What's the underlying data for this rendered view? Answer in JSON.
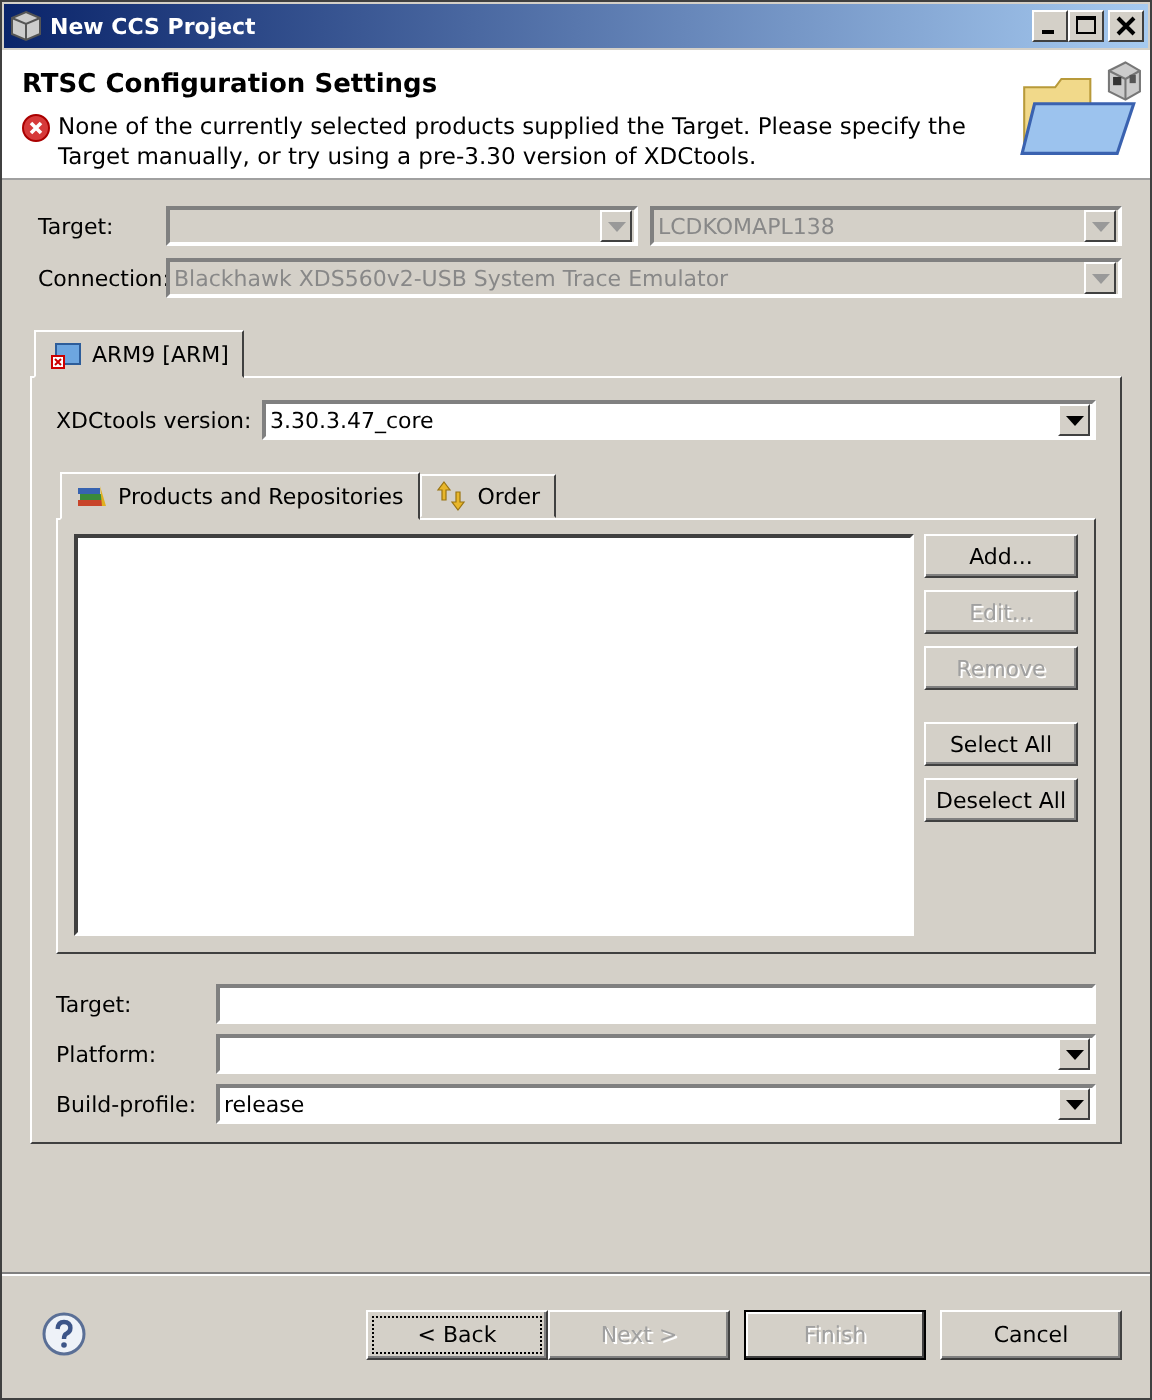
{
  "window": {
    "title": "New CCS Project"
  },
  "header": {
    "title": "RTSC Configuration Settings",
    "message": "None of the currently selected products supplied the Target. Please specify the Target manually, or try using a pre-3.30 version of XDCtools."
  },
  "device": {
    "target_label": "Target:",
    "target_combos": [
      {
        "disabled": true
      },
      {
        "value": "LCDKOMAPL138",
        "disabled": true
      }
    ],
    "connection_label": "Connection:",
    "connection": {
      "value": "Blackhawk XDS560v2-USB System Trace Emulator",
      "disabled": true
    }
  },
  "core_tabs": [
    {
      "label": "ARM9 [ARM]",
      "selected": true
    }
  ],
  "xdctools": {
    "label": "XDCtools version:",
    "value": "3.30.3.47_core"
  },
  "product_tabs": [
    {
      "label": "Products and Repositories",
      "selected": true,
      "kind": "products"
    },
    {
      "label": "Order",
      "selected": false,
      "kind": "order"
    }
  ],
  "side_buttons": [
    {
      "label": "Add...",
      "disabled": false
    },
    {
      "label": "Edit...",
      "disabled": true
    },
    {
      "label": "Remove",
      "disabled": true
    },
    {
      "label": "Select All",
      "disabled": false
    },
    {
      "label": "Deselect All",
      "disabled": false
    }
  ],
  "fields": [
    {
      "label": "Target:",
      "kind": "text"
    },
    {
      "label": "Platform:",
      "kind": "combo"
    },
    {
      "label": "Build-profile:",
      "kind": "combo",
      "value": "release"
    }
  ],
  "footer_buttons": [
    {
      "label": "< Back",
      "disabled": false,
      "focused": true,
      "default": false
    },
    {
      "label": "Next >",
      "disabled": true,
      "focused": false,
      "default": false
    },
    {
      "label": "Finish",
      "disabled": true,
      "focused": false,
      "default": true
    },
    {
      "label": "Cancel",
      "disabled": false,
      "focused": false,
      "default": false
    }
  ]
}
